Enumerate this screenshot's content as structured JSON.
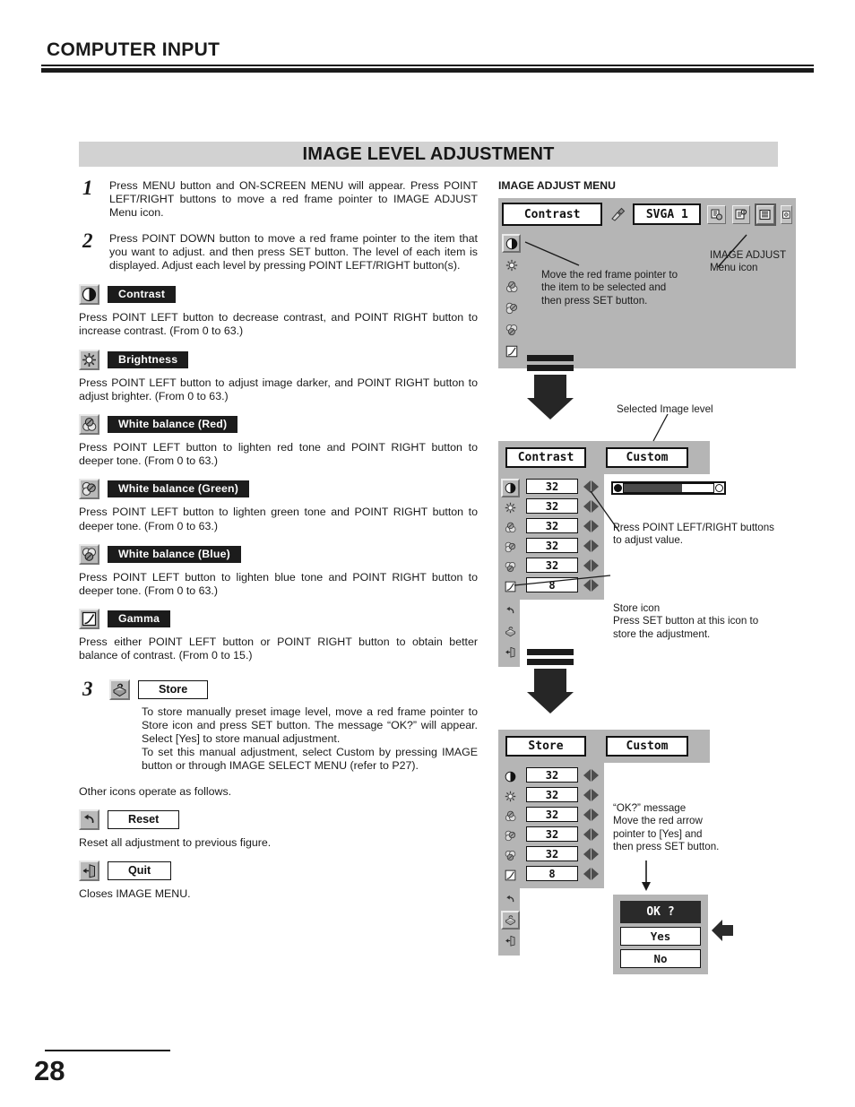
{
  "header": {
    "title": "COMPUTER INPUT"
  },
  "section": {
    "banner_title": "IMAGE LEVEL ADJUSTMENT"
  },
  "steps": [
    {
      "number": "1",
      "text": "Press MENU button and ON-SCREEN MENU will appear.  Press POINT LEFT/RIGHT buttons to move a red frame pointer to IMAGE ADJUST Menu icon."
    },
    {
      "number": "2",
      "text": "Press POINT DOWN button to move a red frame pointer to the item that you want to adjust. and then press SET button.  The level of each item is displayed.  Adjust each level by pressing POINT LEFT/RIGHT button(s)."
    }
  ],
  "items": [
    {
      "icon": "contrast-icon",
      "label": "Contrast",
      "desc": "Press POINT LEFT button to decrease contrast, and POINT RIGHT button to increase contrast.  (From 0 to 63.)"
    },
    {
      "icon": "brightness-icon",
      "label": "Brightness",
      "desc": "Press POINT LEFT button to adjust image darker, and POINT RIGHT button to adjust brighter.  (From 0 to 63.)"
    },
    {
      "icon": "white-balance-red-icon",
      "label": "White balance (Red)",
      "desc": "Press POINT LEFT button to lighten red tone and POINT RIGHT button to deeper tone.  (From 0 to 63.)"
    },
    {
      "icon": "white-balance-green-icon",
      "label": "White balance (Green)",
      "desc": "Press POINT LEFT button to lighten green tone and POINT RIGHT button to deeper tone.  (From 0 to 63.)"
    },
    {
      "icon": "white-balance-blue-icon",
      "label": "White balance (Blue)",
      "desc": "Press POINT LEFT button to lighten blue tone and POINT RIGHT button to deeper tone.  (From 0 to 63.)"
    },
    {
      "icon": "gamma-icon",
      "label": "Gamma",
      "desc": "Press either POINT LEFT button or POINT RIGHT button to obtain better balance of contrast.  (From 0 to 15.)"
    }
  ],
  "step3": {
    "number": "3",
    "label": "Store",
    "icon": "store-icon",
    "para1": "To store manually preset image level, move a red frame pointer to Store icon and press SET button.  The message “OK?” will appear.  Select [Yes] to store manual adjustment.",
    "para2": "To set this manual adjustment, select Custom by pressing IMAGE button or through IMAGE SELECT MENU (refer to P27).",
    "other_icons_line": "Other icons operate as follows."
  },
  "reset": {
    "icon": "reset-icon",
    "label": "Reset",
    "desc": "Reset all adjustment to previous figure."
  },
  "quit": {
    "icon": "quit-icon",
    "label": "Quit",
    "desc": "Closes IMAGE MENU."
  },
  "right": {
    "menu_title": "IMAGE ADJUST MENU",
    "top_menu": {
      "field_label": "Contrast",
      "source_label": "SVGA 1",
      "icons": [
        "pc-adjust-icon",
        "system-icon",
        "image-select-icon",
        "image-adjust-icon",
        "setting-icon"
      ],
      "selected_icon": "image-adjust-icon"
    },
    "annotations": {
      "image_adjust_menu_icon": "IMAGE ADJUST\nMenu icon",
      "move_pointer": "Move the red frame pointer to\nthe item to be selected and\nthen press SET button.",
      "selected_image_level": "Selected Image level",
      "press_point_lr": "Press POINT LEFT/RIGHT buttons\nto adjust value.",
      "store_icon_note": "Store icon\nPress SET button at this icon to\nstore the adjustment.",
      "ok_message": "“OK?” message\nMove the red arrow\npointer to [Yes] and\nthen press SET button."
    },
    "adjust_panel": {
      "field_label": "Contrast",
      "level_label": "Custom",
      "values": [
        "32",
        "32",
        "32",
        "32",
        "32",
        "8"
      ],
      "icons": [
        "contrast-icon",
        "brightness-icon",
        "white-balance-red-icon",
        "white-balance-green-icon",
        "white-balance-blue-icon",
        "gamma-icon"
      ],
      "footer_icons": [
        "reset-icon",
        "store-icon",
        "quit-icon"
      ],
      "slider_percent": 65
    },
    "store_panel": {
      "field_label": "Store",
      "level_label": "Custom",
      "values": [
        "32",
        "32",
        "32",
        "32",
        "32",
        "8"
      ],
      "icons": [
        "contrast-icon",
        "brightness-icon",
        "white-balance-red-icon",
        "white-balance-green-icon",
        "white-balance-blue-icon",
        "gamma-icon"
      ],
      "footer_icons": [
        "reset-icon",
        "store-icon",
        "quit-icon"
      ]
    },
    "dialog": {
      "title": "OK ?",
      "yes_label": "Yes",
      "no_label": "No"
    }
  },
  "footer": {
    "page_number": "28"
  },
  "colors": {
    "banner_bg": "#d2d2d2",
    "osd_bg": "#b5b5b5",
    "ink": "#1a1a1a",
    "badge_dark": "#1c1c1c"
  }
}
